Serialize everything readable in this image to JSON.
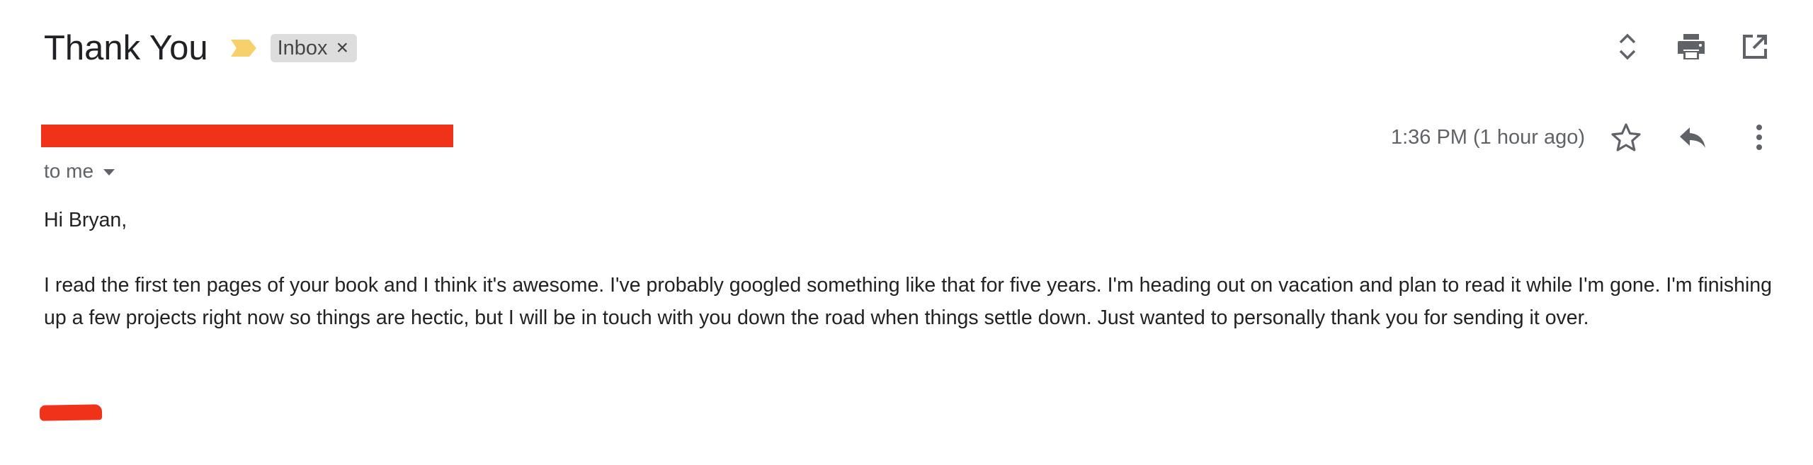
{
  "email": {
    "subject": "Thank You",
    "label": "Inbox",
    "label_remove": "×",
    "recipient_text": "to me",
    "timestamp": "1:36 PM (1 hour ago)",
    "greeting": "Hi Bryan,",
    "body": "I read the first ten pages of your book and I think it's awesome. I've probably googled something like that for five years. I'm heading out on vacation and plan to read it while I'm gone. I'm finishing up a few projects right now so things are hectic, but I will be in touch with you down the road when things settle down. Just wanted to personally thank you for sending it over."
  },
  "icons": {
    "importance": "importance-marker-icon",
    "expand": "expand-collapse-icon",
    "print": "print-icon",
    "open_new": "open-in-new-window-icon",
    "star": "star-icon",
    "reply": "reply-icon",
    "more": "more-vert-icon"
  },
  "colors": {
    "importance": "#f7cf6b",
    "redaction": "#f0321b",
    "label_bg": "#dddddd",
    "icon": "#5f6368"
  }
}
